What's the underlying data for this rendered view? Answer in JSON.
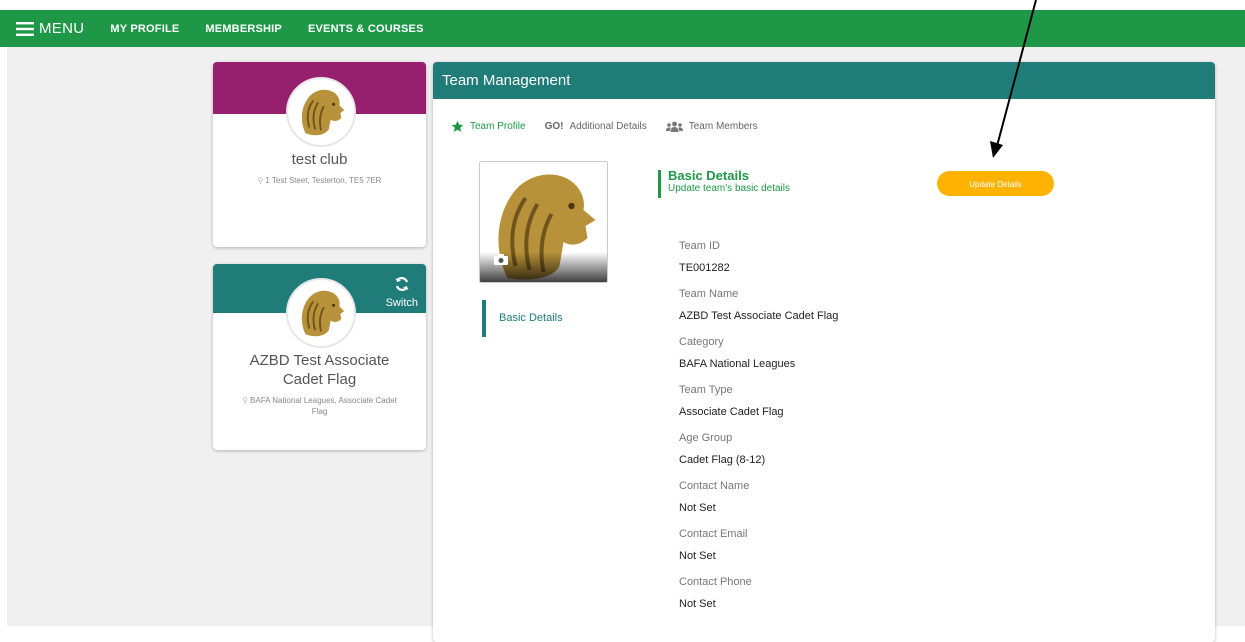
{
  "nav": {
    "menu_label": "MENU",
    "links": [
      "MY PROFILE",
      "MEMBERSHIP",
      "EVENTS & COURSES"
    ],
    "bg_color": "#1e9846"
  },
  "club_card": {
    "name": "test club",
    "address": "1 Test Steet, Testerton, TE5 7ER",
    "band_color": "#96206d",
    "avatar_icon": "lion-icon"
  },
  "team_card": {
    "name": "AZBD Test Associate Cadet Flag",
    "subtitle": "BAFA National Leagues, Associate Cadet Flag",
    "switch_label": "Switch",
    "band_color": "#1f7c79",
    "avatar_icon": "lion-icon"
  },
  "panel": {
    "title": "Team Management",
    "tabs": [
      {
        "label": "Team Profile",
        "icon": "star-icon",
        "active": true
      },
      {
        "label": "Additional Details",
        "icon": "go-icon",
        "prefix": "GO!",
        "active": false
      },
      {
        "label": "Team Members",
        "icon": "people-icon",
        "active": false
      }
    ],
    "side_nav_label": "Basic Details",
    "section_title": "Basic Details",
    "section_subtitle": "Update team's basic details",
    "update_button": "Update Details",
    "accent_color": "#ffb300",
    "fields": [
      {
        "label": "Team ID",
        "value": "TE001282"
      },
      {
        "label": "Team Name",
        "value": "AZBD Test Associate Cadet Flag"
      },
      {
        "label": "Category",
        "value": "BAFA National Leagues"
      },
      {
        "label": "Team Type",
        "value": "Associate Cadet Flag"
      },
      {
        "label": "Age Group",
        "value": "Cadet Flag (8-12)"
      },
      {
        "label": "Contact Name",
        "value": "Not Set"
      },
      {
        "label": "Contact Email",
        "value": "Not Set"
      },
      {
        "label": "Contact Phone",
        "value": "Not Set"
      }
    ]
  }
}
